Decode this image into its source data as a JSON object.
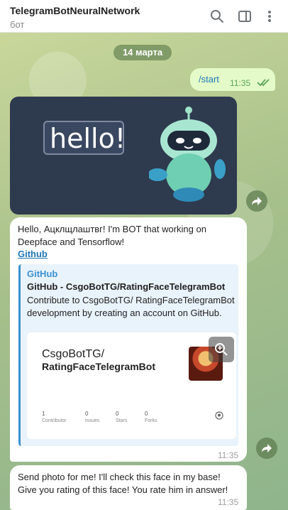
{
  "header": {
    "title": "TelegramBotNeuralNetwork",
    "subtitle": "бот",
    "icons": [
      "search-icon",
      "sidebar-toggle-icon",
      "more-vertical-icon"
    ]
  },
  "date_separator": "14 марта",
  "outgoing": {
    "text": "/start",
    "time": "11:35",
    "status": "read-double-check"
  },
  "photo": {
    "caption_text": "hello!"
  },
  "bot_message": {
    "text": "Hello, Ацклщлаштвг! I'm BOT that working on\nDeepface and Tensorflow!",
    "link_text": "Github",
    "time": "11:35",
    "preview": {
      "site": "GitHub",
      "title": "GitHub - CsgoBotTG/RatingFaceTelegramBot",
      "description": "Contribute to CsgoBotTG/ RatingFaceTelegramBot development by creating an account on GitHub.",
      "card_owner": "CsgoBotTG/",
      "card_repo": "RatingFaceTelegramBot",
      "stats": [
        {
          "value": "1",
          "label": "Contributor"
        },
        {
          "value": "0",
          "label": "Issues"
        },
        {
          "value": "0",
          "label": "Stars"
        },
        {
          "value": "0",
          "label": "Forks"
        }
      ]
    }
  },
  "bot_message2": {
    "text": "Send photo for me! I'll check this face in my base!\nGive you rating of this face! You rate him in answer!",
    "time": "11:35"
  },
  "colors": {
    "accent": "#3a91d1",
    "outgoing_bubble": "#e4fbc9",
    "header_bg": "#ffffff"
  }
}
